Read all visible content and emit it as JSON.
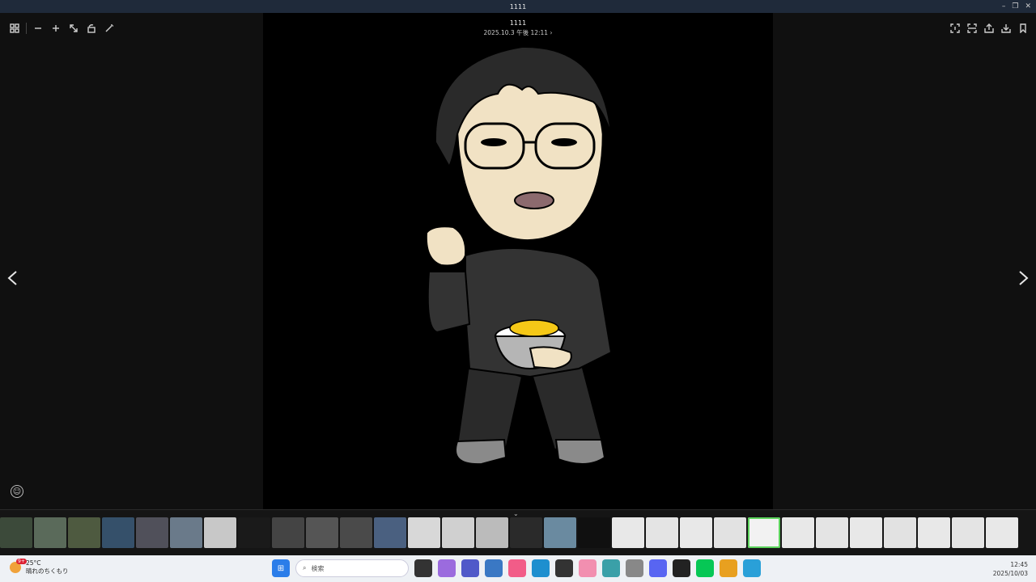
{
  "window": {
    "title": "1111"
  },
  "photo": {
    "title": "1111",
    "date": "2025.10.3 午後 12:11",
    "date_chevron": "›"
  },
  "toolbar_left": [
    "gallery-icon",
    "zoom-out-icon",
    "zoom-in-icon",
    "expand-icon",
    "rotate-icon",
    "enhance-icon"
  ],
  "toolbar_right": [
    "text-recognize-icon",
    "scan-icon",
    "share-icon",
    "download-icon",
    "bookmark-icon"
  ],
  "taskbar": {
    "weather_temp": "25°C",
    "weather_desc": "晴れのちくもり",
    "weather_badge": "9+",
    "search_placeholder": "検索",
    "time": "12:45",
    "date": "2025/10/03"
  },
  "colors": {
    "selected_thumb": "#5bd35b",
    "taskbar_bg": "#eef1f5"
  }
}
